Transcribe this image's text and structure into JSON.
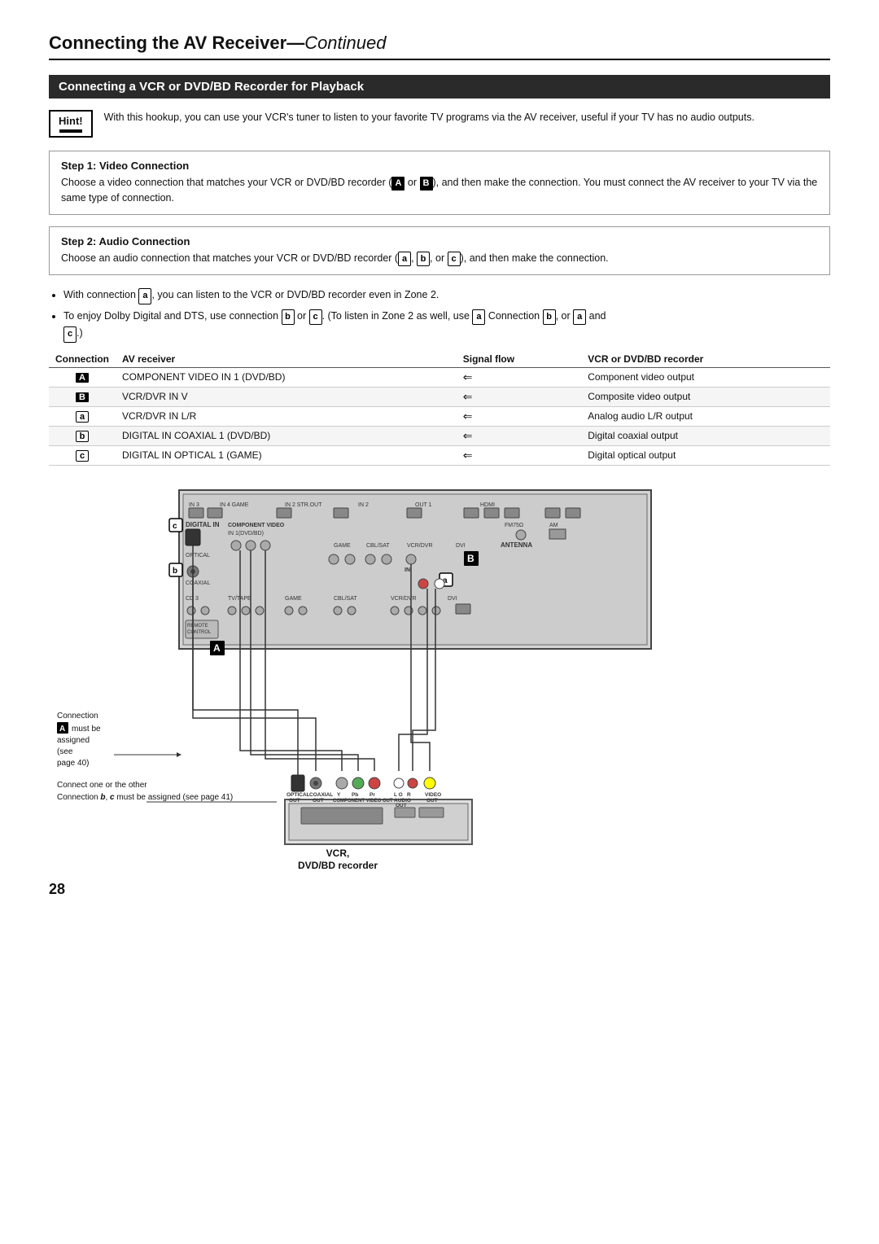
{
  "page": {
    "title": "Connecting the AV Receiver",
    "title_suffix": "Continued",
    "page_number": "28"
  },
  "section": {
    "title": "Connecting a VCR or DVD/BD Recorder for Playback"
  },
  "hint": {
    "label": "Hint!",
    "text": "With this hookup, you can use your VCR's tuner to listen to your favorite TV programs via the AV receiver, useful if your TV has no audio outputs."
  },
  "steps": [
    {
      "number": "1",
      "title": "Step 1: Video Connection",
      "text": "Choose a video connection that matches your VCR or DVD/BD recorder (A or B), and then make the connection. You must connect the AV receiver to your TV via the same type of connection."
    },
    {
      "number": "2",
      "title": "Step 2: Audio Connection",
      "text": "Choose an audio connection that matches your VCR or DVD/BD recorder (a, b, or c), and then make the connection."
    }
  ],
  "bullets": [
    "With connection a, you can listen to the VCR or DVD/BD recorder even in Zone 2.",
    "To enjoy Dolby Digital and DTS, use connection b or c. (To listen in Zone 2 as well, use a and b, or a and c.)"
  ],
  "table": {
    "headers": [
      "Connection",
      "AV receiver",
      "Signal flow",
      "VCR or DVD/BD recorder"
    ],
    "rows": [
      {
        "conn": "A",
        "conn_type": "block",
        "av_receiver": "COMPONENT VIDEO IN 1 (DVD/BD)",
        "signal": "⇐",
        "vcr": "Component video output"
      },
      {
        "conn": "B",
        "conn_type": "block",
        "av_receiver": "VCR/DVR IN V",
        "signal": "⇐",
        "vcr": "Composite video output"
      },
      {
        "conn": "a",
        "conn_type": "block_small",
        "av_receiver": "VCR/DVR IN L/R",
        "signal": "⇐",
        "vcr": "Analog audio L/R output"
      },
      {
        "conn": "b",
        "conn_type": "block_small",
        "av_receiver": "DIGITAL IN COAXIAL 1 (DVD/BD)",
        "signal": "⇐",
        "vcr": "Digital coaxial output"
      },
      {
        "conn": "c",
        "conn_type": "block_small",
        "av_receiver": "DIGITAL IN OPTICAL 1 (GAME)",
        "signal": "⇐",
        "vcr": "Digital optical output"
      }
    ]
  },
  "diagram": {
    "note_a": "Connection A must be assigned (see page 40)",
    "note_bc": "Connect one or the other\nConnection b, c must be assigned (see page 41)",
    "vcr_label": "VCR,",
    "vcr_label2": "DVD/BD recorder"
  }
}
